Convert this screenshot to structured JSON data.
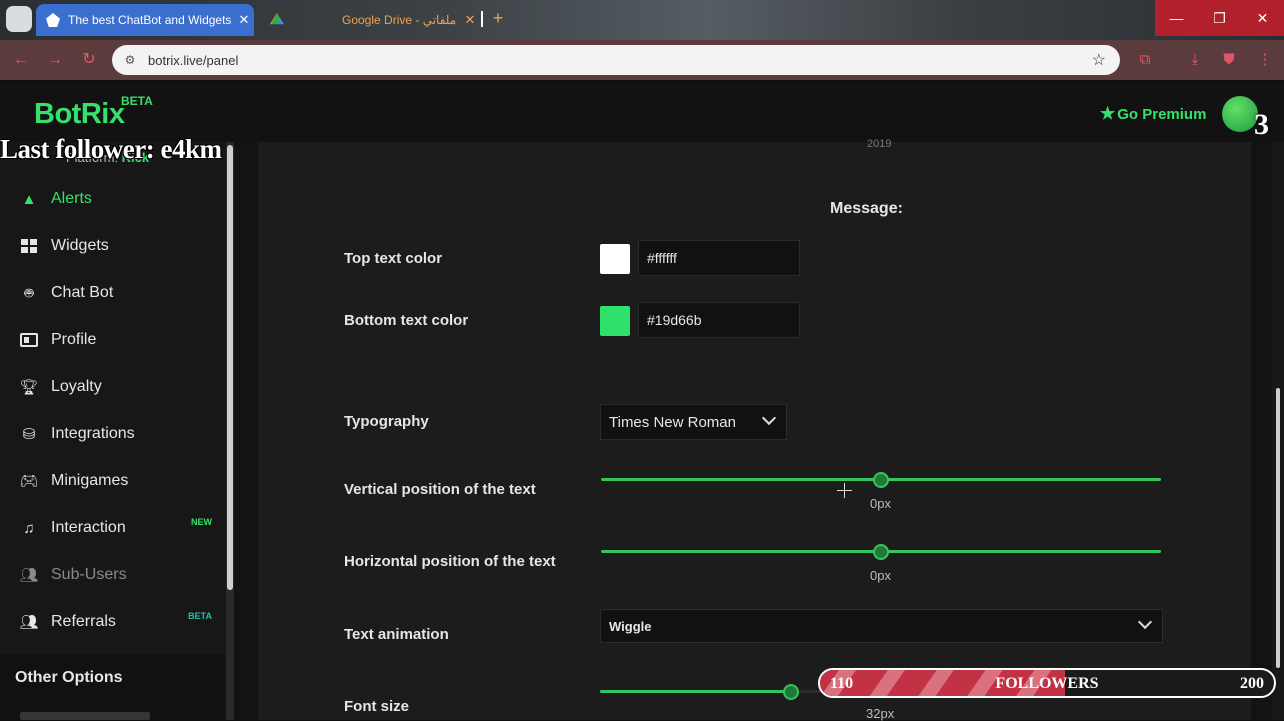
{
  "browser": {
    "tabs": [
      {
        "title": "The best ChatBot and Widgets",
        "active": true
      },
      {
        "title": "Google Drive - ملفاتي",
        "active": false
      }
    ],
    "url": "botrix.live/panel"
  },
  "header": {
    "logo": "BotRix",
    "logo_badge": "BETA",
    "premium_label": "Go Premium",
    "avatar_count": "3"
  },
  "overlay": {
    "last_follower": "Last follower: e4km",
    "follower_goal": {
      "current": "110",
      "label": "FOLLOWERS",
      "target": "200",
      "progress": 0.54
    }
  },
  "sidebar": {
    "platform_label": "Platform:",
    "platform_value": "Kick",
    "items": [
      {
        "label": "Alerts",
        "icon": "warning-icon",
        "active": true
      },
      {
        "label": "Widgets",
        "icon": "grid-icon"
      },
      {
        "label": "Chat Bot",
        "icon": "robot-icon"
      },
      {
        "label": "Profile",
        "icon": "id-card-icon"
      },
      {
        "label": "Loyalty",
        "icon": "trophy-icon"
      },
      {
        "label": "Integrations",
        "icon": "plug-icon"
      },
      {
        "label": "Minigames",
        "icon": "gamepad-icon"
      },
      {
        "label": "Interaction",
        "icon": "music-note-icon",
        "badge": "NEW"
      },
      {
        "label": "Sub-Users",
        "icon": "users-icon",
        "disabled": true
      },
      {
        "label": "Referrals",
        "icon": "user-group-icon",
        "badge": "BETA"
      }
    ],
    "other_options_title": "Other Options"
  },
  "main": {
    "cut_text": "2019",
    "section_title": "Message:",
    "top_text_color": {
      "label": "Top text color",
      "value": "#ffffff",
      "swatch": "#ffffff"
    },
    "bottom_text_color": {
      "label": "Bottom text color",
      "value": "#19d66b",
      "swatch": "#2fe06a"
    },
    "typography": {
      "label": "Typography",
      "value": "Times New Roman"
    },
    "vertical_position": {
      "label": "Vertical position of the text",
      "value": "0px",
      "fraction": 0.5
    },
    "horizontal_position": {
      "label": "Horizontal position of the text",
      "value": "0px",
      "fraction": 0.5
    },
    "text_animation": {
      "label": "Text animation",
      "value": "Wiggle"
    },
    "font_size": {
      "label": "Font size",
      "value": "32px",
      "fraction": 0.34
    }
  },
  "colors": {
    "accent": "#36e06a",
    "panel": "#1c1c1c",
    "sidebar": "#171717"
  }
}
